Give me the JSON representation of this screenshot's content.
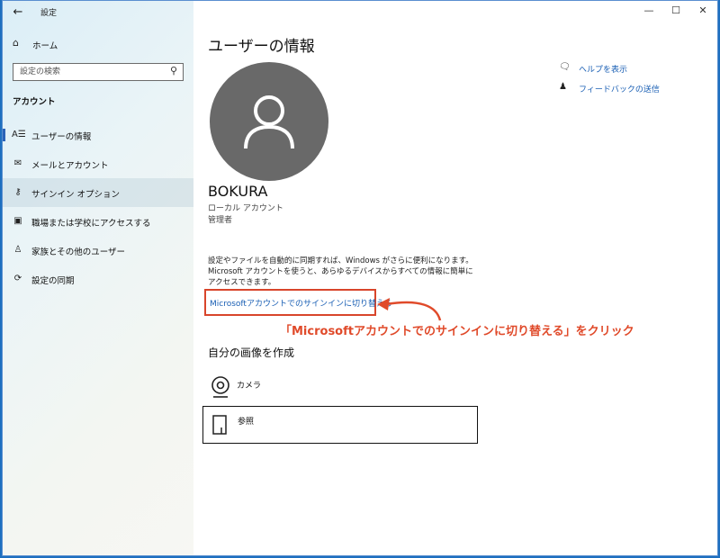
{
  "window": {
    "app_title": "設定",
    "controls": {
      "minimize": "—",
      "maximize": "☐",
      "close": "✕"
    }
  },
  "sidebar": {
    "back_icon": "back-arrow-icon",
    "home_label": "ホーム",
    "search_placeholder": "設定の検索",
    "section_title": "アカウント",
    "items": [
      {
        "label": "ユーザーの情報",
        "icon": "user-info-icon",
        "selected": false
      },
      {
        "label": "メールとアカウント",
        "icon": "mail-icon",
        "selected": false
      },
      {
        "label": "サインイン オプション",
        "icon": "key-icon",
        "selected": true
      },
      {
        "label": "職場または学校にアクセスする",
        "icon": "briefcase-icon",
        "selected": false
      },
      {
        "label": "家族とその他のユーザー",
        "icon": "person-icon",
        "selected": false
      },
      {
        "label": "設定の同期",
        "icon": "sync-icon",
        "selected": false
      }
    ]
  },
  "main": {
    "page_title": "ユーザーの情報",
    "username": "BOKURA",
    "account_type": "ローカル アカウント",
    "account_role": "管理者",
    "description": "設定やファイルを自動的に同期すれば、Windows がさらに便利になります。Microsoft アカウントを使うと、あらゆるデバイスからすべての情報に簡単にアクセスできます。",
    "switch_link": "Microsoftアカウントでのサインインに切り替える",
    "create_picture_title": "自分の画像を作成",
    "camera_label": "カメラ",
    "browse_label": "参照"
  },
  "help": {
    "help_label": "ヘルプを表示",
    "feedback_label": "フィードバックの送信"
  },
  "annotation": {
    "text": "「Microsoftアカウントでのサインインに切り替える」をクリック",
    "color": "#e04a2a"
  },
  "colors": {
    "accent": "#1a5fb4",
    "highlight_border": "#d8452b",
    "avatar_bg": "#696969"
  }
}
